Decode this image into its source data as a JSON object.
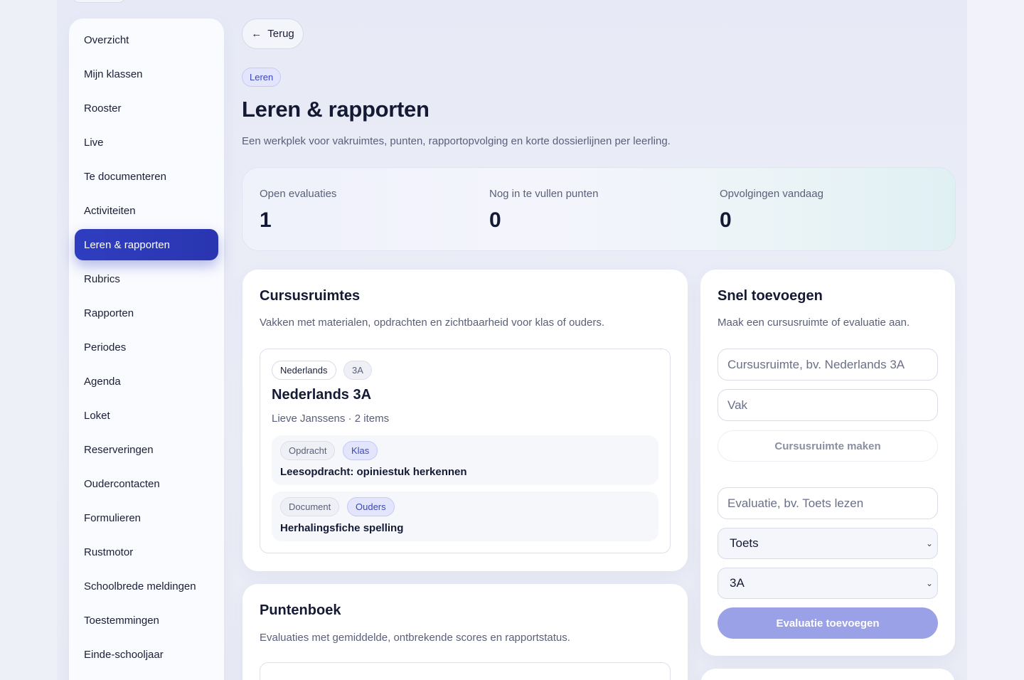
{
  "sidebar": {
    "items": [
      {
        "label": "Overzicht"
      },
      {
        "label": "Mijn klassen"
      },
      {
        "label": "Rooster"
      },
      {
        "label": "Live"
      },
      {
        "label": "Te documenteren"
      },
      {
        "label": "Activiteiten"
      },
      {
        "label": "Leren & rapporten"
      },
      {
        "label": "Rubrics"
      },
      {
        "label": "Rapporten"
      },
      {
        "label": "Periodes"
      },
      {
        "label": "Agenda"
      },
      {
        "label": "Loket"
      },
      {
        "label": "Reserveringen"
      },
      {
        "label": "Oudercontacten"
      },
      {
        "label": "Formulieren"
      },
      {
        "label": "Rustmotor"
      },
      {
        "label": "Schoolbrede meldingen"
      },
      {
        "label": "Toestemmingen"
      },
      {
        "label": "Einde-schooljaar"
      }
    ],
    "active": "Leren & rapporten"
  },
  "header": {
    "back_label": "Terug",
    "back_icon": "arrow-left-icon",
    "tag": "Leren",
    "title": "Leren & rapporten",
    "subtitle": "Een werkplek voor vakruimtes, punten, rapportopvolging en korte dossierlijnen per leerling."
  },
  "stats": [
    {
      "label": "Open evaluaties",
      "value": "1"
    },
    {
      "label": "Nog in te vullen punten",
      "value": "0"
    },
    {
      "label": "Opvolgingen vandaag",
      "value": "0"
    }
  ],
  "courses": {
    "title": "Cursusruimtes",
    "subtitle": "Vakken met materialen, opdrachten en zichtbaarheid voor klas of ouders.",
    "course": {
      "subject_chip": "Nederlands",
      "class_chip": "3A",
      "title": "Nederlands 3A",
      "meta": "Lieve Janssens · 2 items",
      "items": [
        {
          "type": "Opdracht",
          "audience": "Klas",
          "title": "Leesopdracht: opiniestuk herkennen"
        },
        {
          "type": "Document",
          "audience": "Ouders",
          "title": "Herhalingsfiche spelling"
        }
      ]
    }
  },
  "gradebook": {
    "title": "Puntenboek",
    "subtitle": "Evaluaties met gemiddelde, ontbrekende scores en rapportstatus."
  },
  "quick_add": {
    "title": "Snel toevoegen",
    "subtitle": "Maak een cursusruimte of evaluatie aan.",
    "course_placeholder": "Cursusruimte, bv. Nederlands 3A",
    "subject_placeholder": "Vak",
    "create_course_label": "Cursusruimte maken",
    "evaluation_placeholder": "Evaluatie, bv. Toets lezen",
    "type_selected": "Toets",
    "class_selected": "3A",
    "add_evaluation_label": "Evaluatie toevoegen"
  },
  "colors": {
    "accent": "#2f3dc0",
    "primary_disabled": "#9aa1e6",
    "chip_blue_bg": "#e2e5fb",
    "text_dark": "#141a33"
  }
}
